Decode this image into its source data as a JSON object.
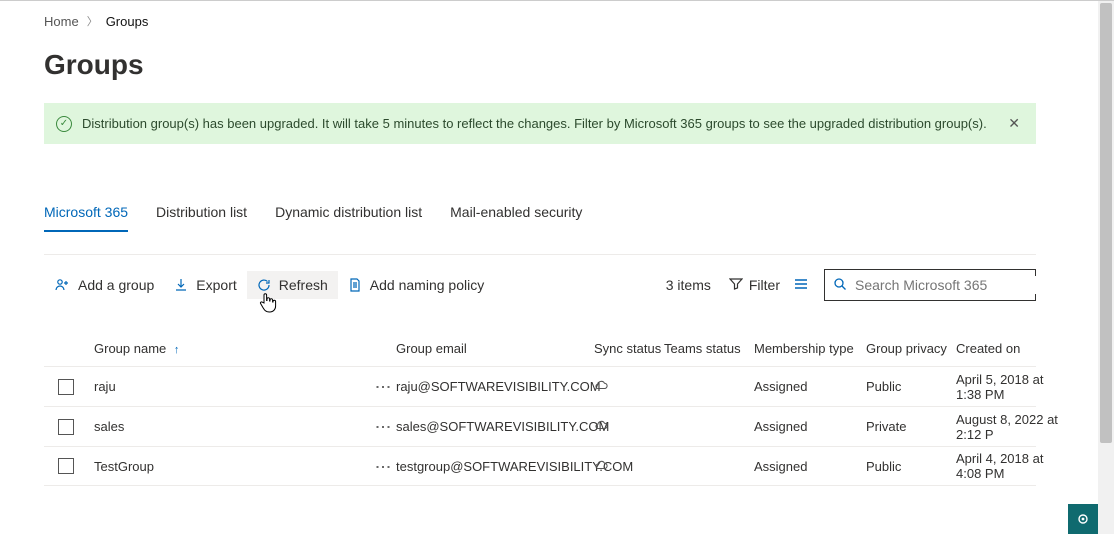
{
  "breadcrumb": {
    "home": "Home",
    "current": "Groups"
  },
  "page_title": "Groups",
  "message_bar": {
    "text": "Distribution group(s) has been upgraded. It will take 5 minutes to reflect the changes. Filter by Microsoft 365 groups to see the upgraded distribution group(s)."
  },
  "tabs": {
    "t0": "Microsoft 365",
    "t1": "Distribution list",
    "t2": "Dynamic distribution list",
    "t3": "Mail-enabled security"
  },
  "commands": {
    "add": "Add a group",
    "export": "Export",
    "refresh": "Refresh",
    "naming": "Add naming policy"
  },
  "summary": {
    "items": "3 items",
    "filter": "Filter"
  },
  "search_placeholder": "Search Microsoft 365",
  "columns": {
    "name": "Group name",
    "email": "Group email",
    "sync": "Sync status",
    "teams": "Teams status",
    "membership": "Membership type",
    "privacy": "Group privacy",
    "created": "Created on"
  },
  "rows": [
    {
      "name": "raju",
      "email": "raju@SOFTWAREVISIBILITY.COM",
      "membership": "Assigned",
      "privacy": "Public",
      "created": "April 5, 2018 at 1:38 PM"
    },
    {
      "name": "sales",
      "email": "sales@SOFTWAREVISIBILITY.COM",
      "membership": "Assigned",
      "privacy": "Private",
      "created": "August 8, 2022 at 2:12 P"
    },
    {
      "name": "TestGroup",
      "email": "testgroup@SOFTWAREVISIBILITY.COM",
      "membership": "Assigned",
      "privacy": "Public",
      "created": "April 4, 2018 at 4:08 PM"
    }
  ]
}
